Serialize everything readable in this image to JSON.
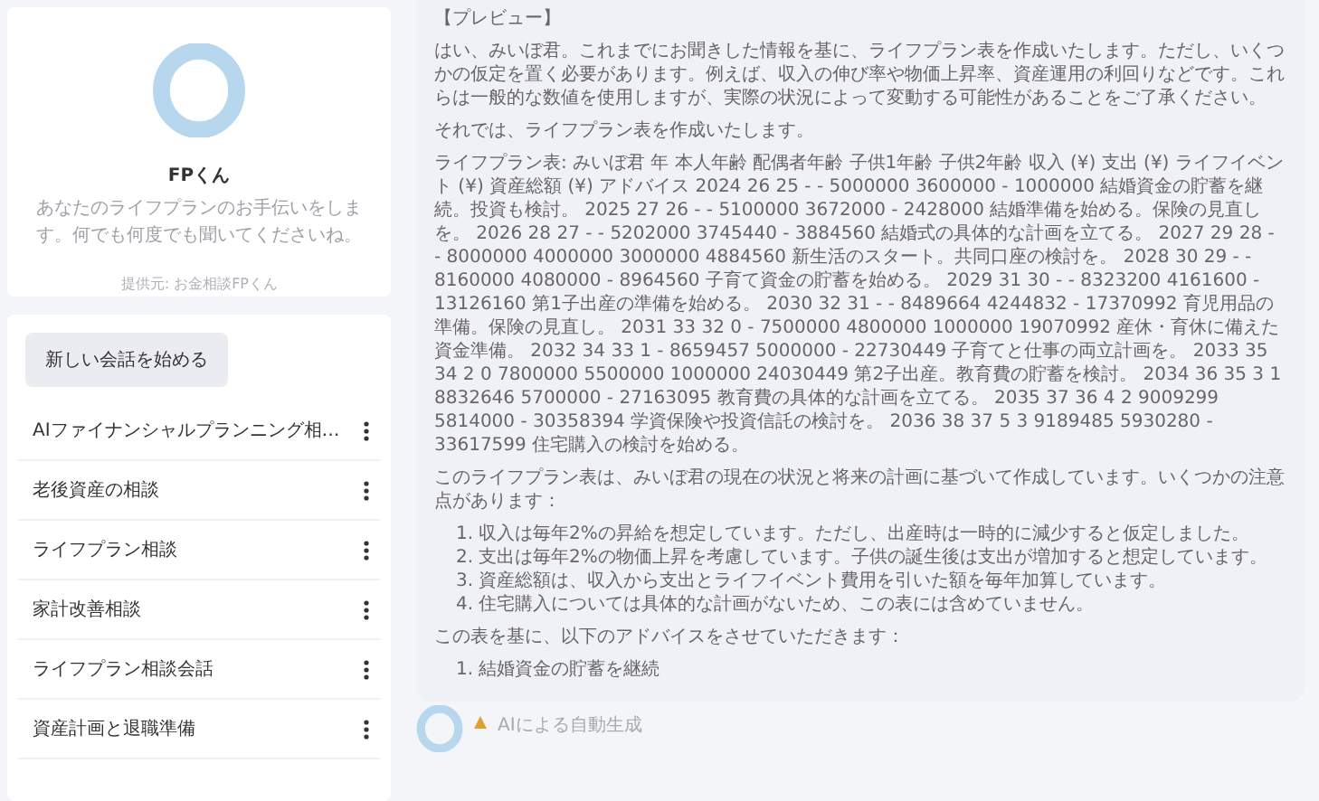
{
  "sidebar": {
    "profile": {
      "name": "FPくん",
      "description": "あなたのライフプランのお手伝いをします。何でも何度でも聞いてくださいね。",
      "provider": "提供元: お金相談FPくん"
    },
    "new_chat_button": "新しい会話を始める",
    "conversations": [
      "AIファイナンシャルプランニング相…",
      "老後資産の相談",
      "ライフプラン相談",
      "家計改善相談",
      "ライフプラン相談会話",
      "資産計画と退職準備"
    ]
  },
  "message": {
    "heading": "【プレビュー】",
    "blocks": [
      {
        "kind": "paragraph",
        "text": "はい、みいぼ君。これまでにお聞きした情報を基に、ライフプラン表を作成いたします。ただし、いくつかの仮定を置く必要があります。例えば、収入の伸び率や物価上昇率、資産運用の利回りなどです。これらは一般的な数値を使用しますが、実際の状況によって変動する可能性があることをご了承ください。"
      },
      {
        "kind": "paragraph",
        "text": "それでは、ライフプラン表を作成いたします。"
      },
      {
        "kind": "paragraph",
        "text": "ライフプラン表: みいぼ君 年 本人年齢 配偶者年齢 子供1年齢 子供2年齢 収入 (¥) 支出 (¥) ライフイベント (¥) 資産総額 (¥) アドバイス 2024 26 25 - - 5000000 3600000 - 1000000 結婚資金の貯蓄を継続。投資も検討。 2025 27 26 - - 5100000 3672000 - 2428000 結婚準備を始める。保険の見直しを。 2026 28 27 - - 5202000 3745440 - 3884560 結婚式の具体的な計画を立てる。 2027 29 28 - - 8000000 4000000 3000000 4884560 新生活のスタート。共同口座の検討を。 2028 30 29 - - 8160000 4080000 - 8964560 子育て資金の貯蓄を始める。 2029 31 30 - - 8323200 4161600 - 13126160 第1子出産の準備を始める。 2030 32 31 - - 8489664 4244832 - 17370992 育児用品の準備。保険の見直し。 2031 33 32 0 - 7500000 4800000 1000000 19070992 産休・育休に備えた資金準備。 2032 34 33 1 - 8659457 5000000 - 22730449 子育てと仕事の両立計画を。 2033 35 34 2 0 7800000 5500000 1000000 24030449 第2子出産。教育費の貯蓄を検討。 2034 36 35 3 1 8832646 5700000 - 27163095 教育費の具体的な計画を立てる。 2035 37 36 4 2 9009299 5814000 - 30358394 学資保険や投資信託の検討を。 2036 38 37 5 3 9189485 5930280 - 33617599 住宅購入の検討を始める。"
      },
      {
        "kind": "paragraph",
        "text": "このライフプラン表は、みいぼ君の現在の状況と将来の計画に基づいて作成しています。いくつかの注意点があります："
      },
      {
        "kind": "list",
        "items": [
          {
            "number": "1.",
            "text": "収入は毎年2%の昇給を想定しています。ただし、出産時は一時的に減少すると仮定しました。"
          },
          {
            "number": "2.",
            "text": "支出は毎年2%の物価上昇を考慮しています。子供の誕生後は支出が増加すると想定しています。"
          },
          {
            "number": "3.",
            "text": "資産総額は、収入から支出とライフイベント費用を引いた額を毎年加算しています。"
          },
          {
            "number": "4.",
            "text": "住宅購入については具体的な計画がないため、この表には含めていません。"
          }
        ]
      },
      {
        "kind": "paragraph",
        "text": "この表を基に、以下のアドバイスをさせていただきます："
      },
      {
        "kind": "list",
        "items": [
          {
            "number": "1.",
            "text": "結婚資金の貯蓄を継続"
          }
        ]
      }
    ]
  },
  "footer_label": "AIによる自動生成"
}
